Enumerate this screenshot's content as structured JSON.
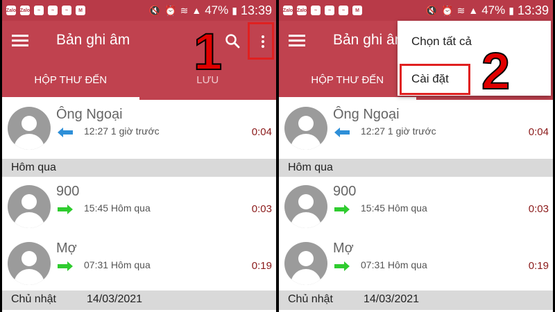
{
  "status_bar": {
    "apps": [
      "Zalo",
      "Zalo",
      "Messenger",
      "Messenger",
      "Messenger",
      "Gmail"
    ],
    "battery": "47%",
    "time": "13:39"
  },
  "app": {
    "title": "Bản ghi âm",
    "icons": [
      "menu-icon",
      "search-icon",
      "more-vert-icon"
    ]
  },
  "tabs": [
    {
      "label": "HỘP THƯ ĐẾN",
      "active": true
    },
    {
      "label": "LƯU",
      "active": false
    }
  ],
  "groups": [
    {
      "header": "",
      "date": "",
      "items": [
        {
          "name": "Ông Ngoại",
          "time": "12:27 1 giờ trước",
          "duration": "0:04",
          "direction": "incoming",
          "arrow_color": "#2e8fd8"
        }
      ]
    },
    {
      "header": "Hôm qua",
      "date": "",
      "items": [
        {
          "name": "900",
          "time": "15:45 Hôm qua",
          "duration": "0:03",
          "direction": "outgoing",
          "arrow_color": "#2fcc2f"
        },
        {
          "name": "Mợ",
          "time": "07:31 Hôm qua",
          "duration": "0:19",
          "direction": "outgoing",
          "arrow_color": "#2fcc2f"
        }
      ]
    },
    {
      "header": "Chủ nhật",
      "date": "14/03/2021",
      "items": []
    }
  ],
  "overflow_menu": {
    "items": [
      "Chọn tất cả",
      "Cài đặt"
    ]
  },
  "annotations": {
    "step1": "1",
    "step2": "2",
    "highlight_color": "#e02020"
  },
  "colors": {
    "status_bar": "#b83a48",
    "app_bar": "#c0424f",
    "duration": "#8b1a1a",
    "section_bg": "#d9d9d9"
  }
}
